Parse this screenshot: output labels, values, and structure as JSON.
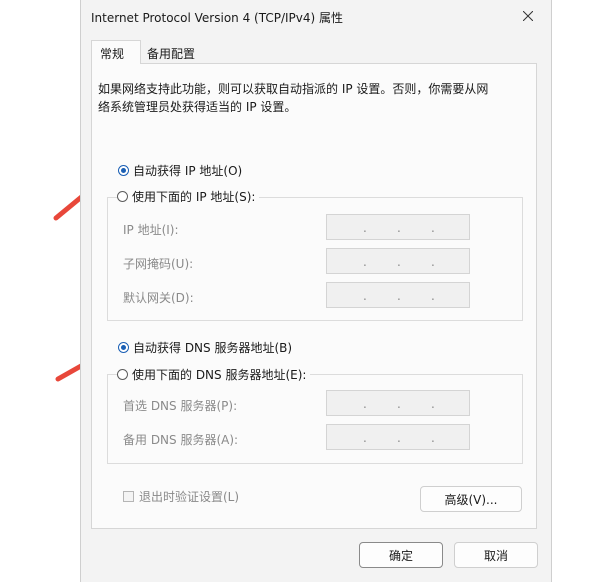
{
  "window": {
    "title": "Internet Protocol Version 4 (TCP/IPv4) 属性",
    "close_icon": "close-icon"
  },
  "tabs": [
    {
      "label": "常规",
      "active": true
    },
    {
      "label": "备用配置",
      "active": false
    }
  ],
  "description": "如果网络支持此功能，则可以获取自动指派的 IP 设置。否则，你需要从网络系统管理员处获得适当的 IP 设置。",
  "ip": {
    "auto_label": "自动获得 IP 地址(O)",
    "auto_selected": true,
    "manual_label": "使用下面的 IP 地址(S):",
    "manual_selected": false,
    "fields": [
      {
        "label": "IP 地址(I):",
        "value": ". . ."
      },
      {
        "label": "子网掩码(U):",
        "value": ". . ."
      },
      {
        "label": "默认网关(D):",
        "value": ". . ."
      }
    ]
  },
  "dns": {
    "auto_label": "自动获得 DNS 服务器地址(B)",
    "auto_selected": true,
    "manual_label": "使用下面的 DNS 服务器地址(E):",
    "manual_selected": false,
    "fields": [
      {
        "label": "首选 DNS 服务器(P):",
        "value": ". . ."
      },
      {
        "label": "备用 DNS 服务器(A):",
        "value": ". . ."
      }
    ]
  },
  "validate_checkbox": {
    "label": "退出时验证设置(L)",
    "checked": false,
    "enabled": false
  },
  "buttons": {
    "advanced": "高级(V)...",
    "ok": "确定",
    "cancel": "取消"
  },
  "colors": {
    "accent": "#1a5fb4",
    "arrow": "#e8473a",
    "disabled_text": "#8a8a8a"
  }
}
